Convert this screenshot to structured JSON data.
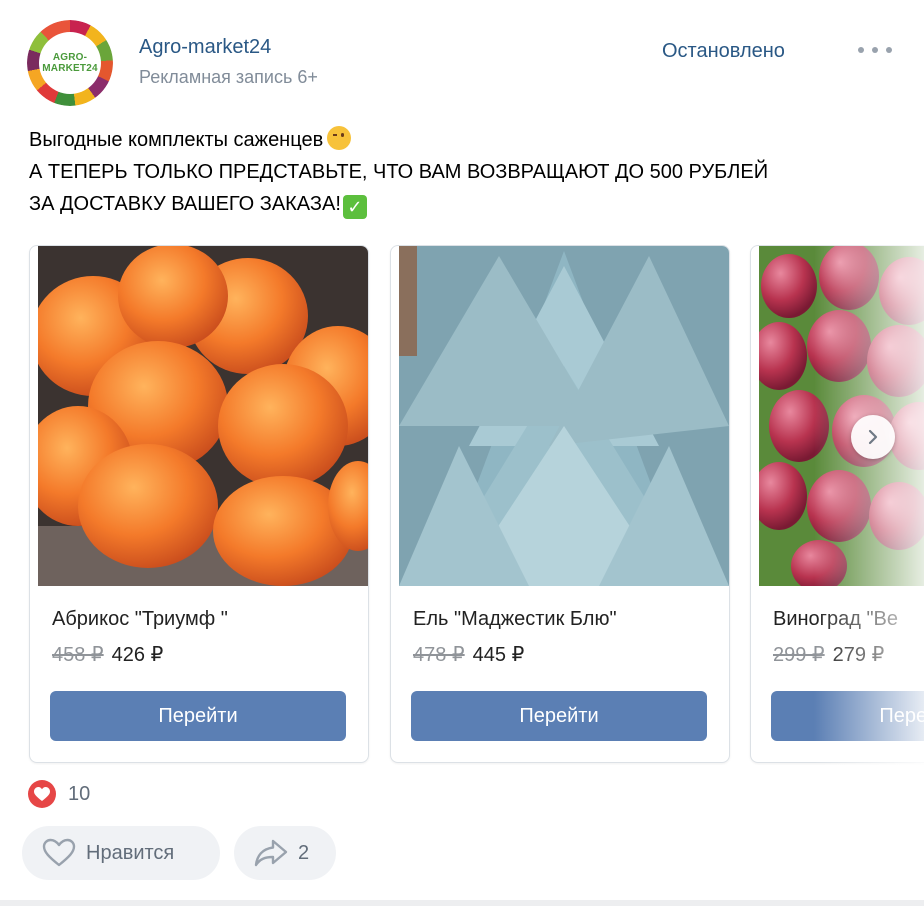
{
  "header": {
    "avatar_text_line1": "AGRO-",
    "avatar_text_line2": "MARKET24",
    "author": "Agro-market24",
    "subtitle": "Рекламная запись 6+",
    "status": "Остановлено",
    "more_icon": "more-horizontal-icon"
  },
  "post": {
    "line1": "Выгодные комплекты саженцев",
    "line2": "А ТЕПЕРЬ ТОЛЬКО ПРЕДСТАВЬТЕ, ЧТО ВАМ ВОЗВРАЩАЮТ ДО 500 РУБЛЕЙ",
    "line3": "ЗА ДОСТАВКУ ВАШЕГО ЗАКАЗА!"
  },
  "carousel": {
    "items": [
      {
        "title": "Абрикос \"Триумф \"",
        "old_price": "458 ₽",
        "new_price": "426 ₽",
        "button": "Перейти",
        "image": "apricots"
      },
      {
        "title": "Ель \"Маджестик Блю\"",
        "old_price": "478 ₽",
        "new_price": "445 ₽",
        "button": "Перейти",
        "image": "blue-spruce"
      },
      {
        "title": "Виноград \"Ве",
        "old_price": "299 ₽",
        "new_price": "279 ₽",
        "button": "Перейти",
        "image": "grapes"
      }
    ]
  },
  "reactions": {
    "likes_count": "10",
    "like_button": "Нравится",
    "share_count": "2"
  },
  "colors": {
    "link": "#2a5885",
    "button": "#5b7fb4",
    "like_red": "#e64646"
  }
}
